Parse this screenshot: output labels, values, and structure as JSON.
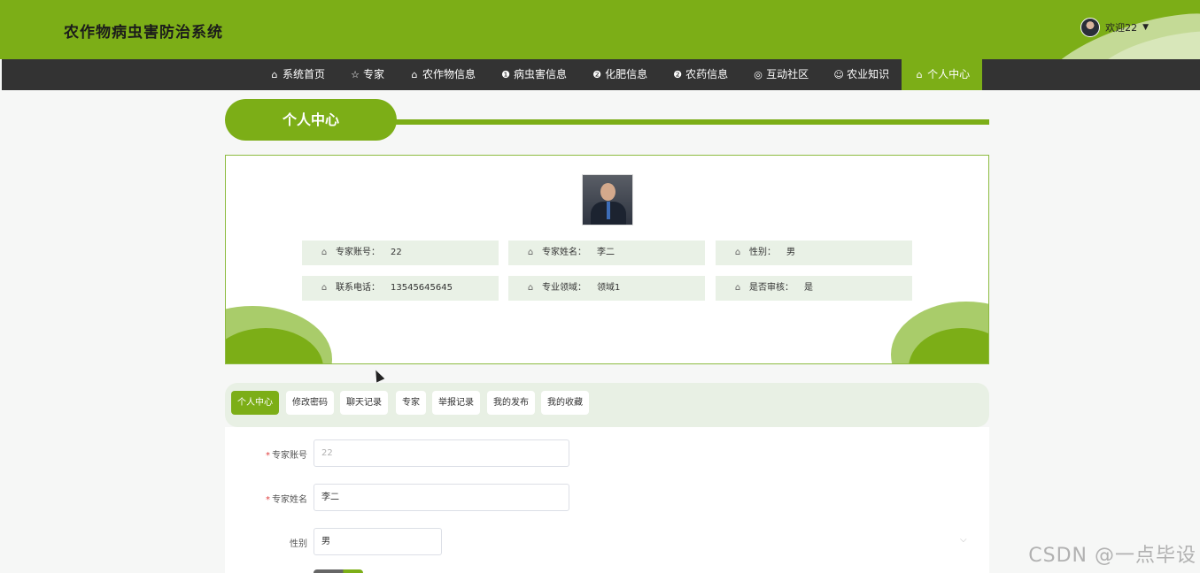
{
  "header": {
    "title": "农作物病虫害防治系统",
    "welcome": "欢迎22",
    "caret": "▼"
  },
  "nav": [
    {
      "icon": "home-icon",
      "glyph": "⌂",
      "label": "系统首页"
    },
    {
      "icon": "star-icon",
      "glyph": "☆",
      "label": "专家"
    },
    {
      "icon": "bag-icon",
      "glyph": "⌂",
      "label": "农作物信息"
    },
    {
      "icon": "info-icon",
      "glyph": "❶",
      "label": "病虫害信息"
    },
    {
      "icon": "help-icon",
      "glyph": "❷",
      "label": "化肥信息"
    },
    {
      "icon": "help-icon",
      "glyph": "❷",
      "label": "农药信息"
    },
    {
      "icon": "globe-icon",
      "glyph": "◎",
      "label": "互动社区"
    },
    {
      "icon": "smile-icon",
      "glyph": "☺",
      "label": "农业知识"
    },
    {
      "icon": "home-icon",
      "glyph": "⌂",
      "label": "个人中心"
    }
  ],
  "section_title": "个人中心",
  "profile": {
    "fields": [
      {
        "label": "专家账号：",
        "value": "22"
      },
      {
        "label": "专家姓名：",
        "value": "李二"
      },
      {
        "label": "性别：",
        "value": "男"
      },
      {
        "label": "联系电话：",
        "value": "13545645645"
      },
      {
        "label": "专业领域：",
        "value": "领域1"
      },
      {
        "label": "是否审核：",
        "value": "是"
      }
    ]
  },
  "tabs": [
    "个人中心",
    "修改密码",
    "聊天记录",
    "专家",
    "举报记录",
    "我的发布",
    "我的收藏"
  ],
  "form": {
    "account_label": "专家账号",
    "account_value": "22",
    "name_label": "专家姓名",
    "name_value": "李二",
    "gender_label": "性别",
    "gender_value": "男",
    "required_mark": "*"
  },
  "watermark": "CSDN @一点毕设",
  "colors": {
    "accent": "#7cae17",
    "nav_bg": "#333333",
    "info_bg": "#e9f1e6"
  }
}
